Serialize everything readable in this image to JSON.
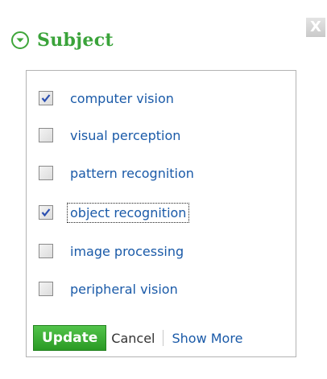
{
  "header": {
    "title": "Subject",
    "close_label": "X"
  },
  "options": [
    {
      "label": "computer vision",
      "checked": true
    },
    {
      "label": "visual perception",
      "checked": false
    },
    {
      "label": "pattern recognition",
      "checked": false
    },
    {
      "label": "object recognition",
      "checked": true,
      "focused": true
    },
    {
      "label": "image processing",
      "checked": false
    },
    {
      "label": "peripheral vision",
      "checked": false
    }
  ],
  "footer": {
    "update_label": "Update",
    "cancel_label": "Cancel",
    "show_more_label": "Show More"
  },
  "colors": {
    "accent_green": "#3aa33a",
    "link_blue": "#1a5aa8",
    "check_blue": "#2b4fb0"
  }
}
